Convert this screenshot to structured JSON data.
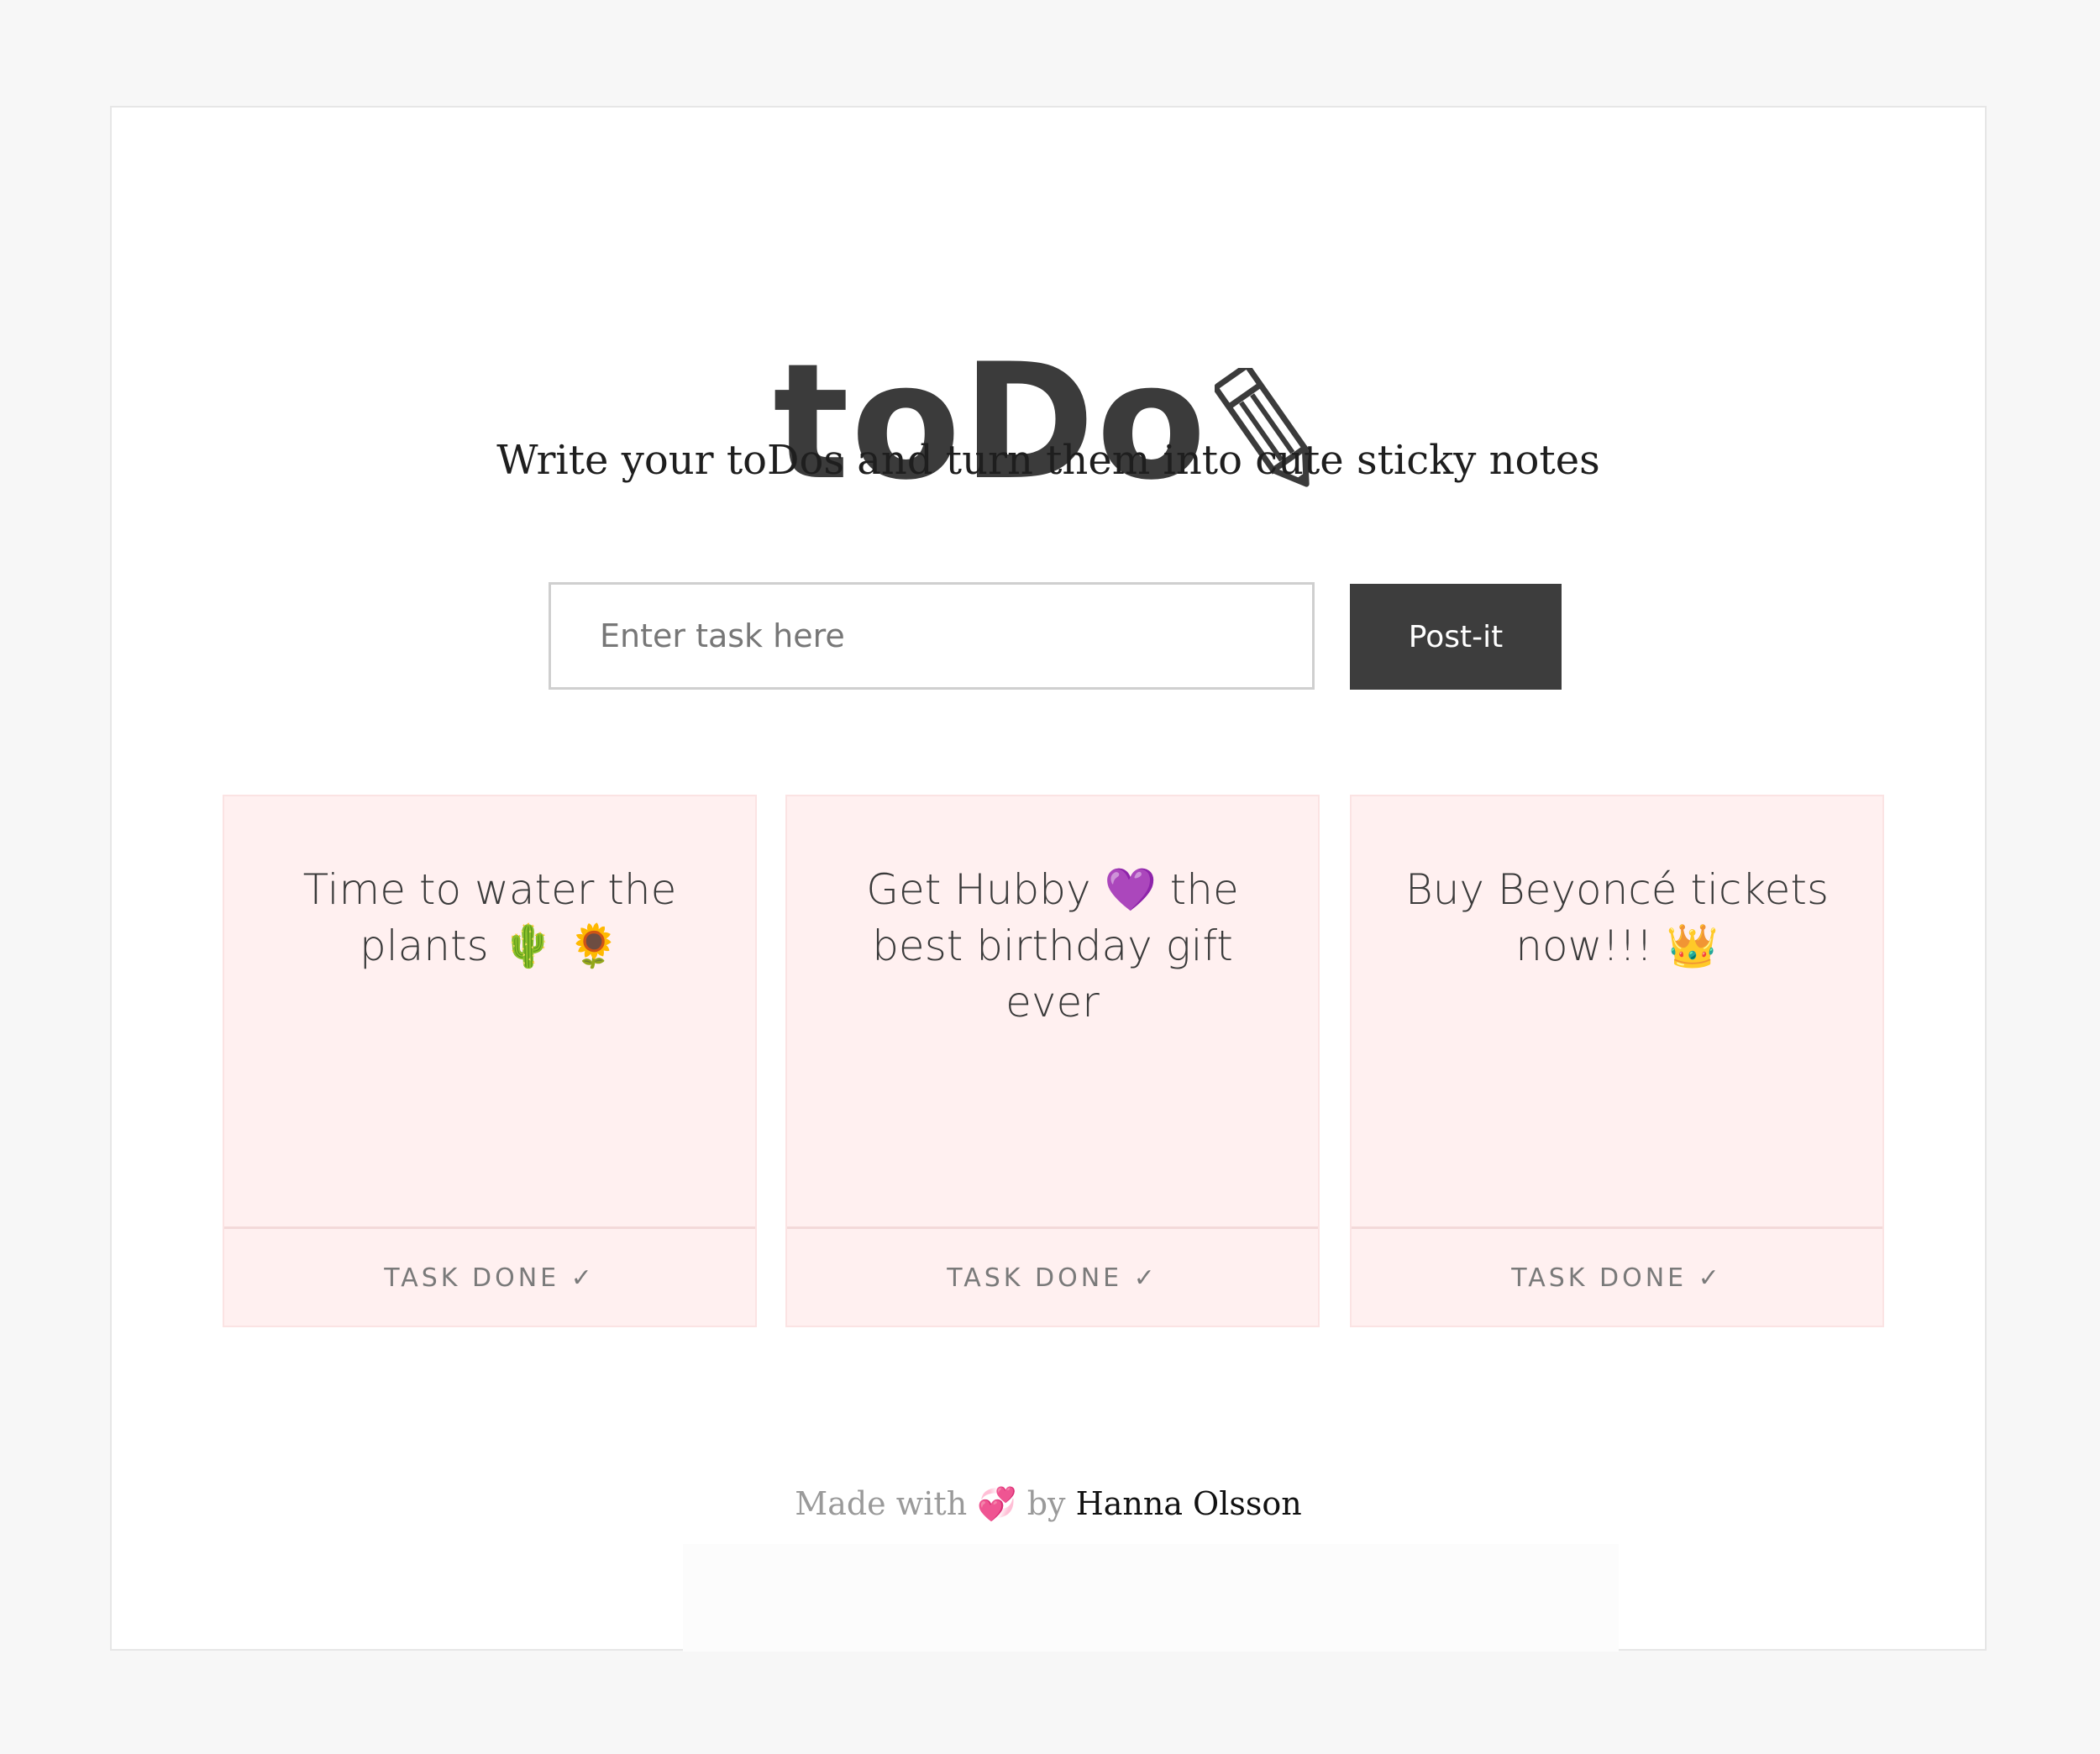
{
  "header": {
    "logo_text": "toDo",
    "logo_icon": "pencil-icon",
    "tagline": "Write your toDos and turn them into cute sticky notes"
  },
  "form": {
    "placeholder": "Enter task here",
    "value": "",
    "button_label": "Post-it"
  },
  "notes": [
    {
      "text": "Time to water the plants 🌵 🌻",
      "done_label": "TASK DONE ✓"
    },
    {
      "text": "Get Hubby 💜  the best birthday gift ever",
      "done_label": "TASK DONE ✓"
    },
    {
      "text": "Buy Beyoncé tickets now!!! 👑",
      "done_label": "TASK DONE ✓"
    }
  ],
  "footer": {
    "made_with": "Made with",
    "heart": "💞",
    "by": "by",
    "author": "Hanna Olsson"
  },
  "colors": {
    "button_bg": "#3d3d3d",
    "note_bg": "#fff0f0",
    "logo": "#3b3b3b"
  }
}
